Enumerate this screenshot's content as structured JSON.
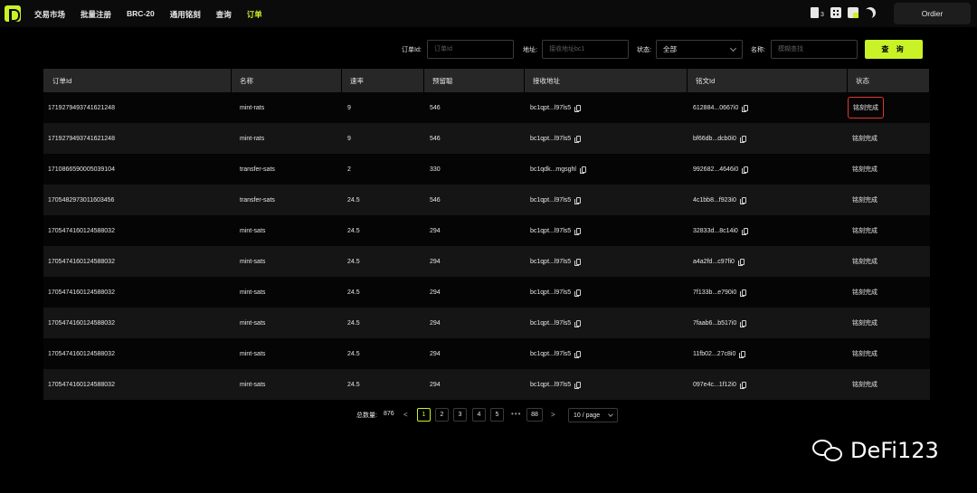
{
  "nav": {
    "items": [
      "交易市场",
      "批量注册",
      "BRC-20",
      "通用铭刻",
      "查询",
      "订单"
    ],
    "active_index": 5
  },
  "toolbar": {
    "file_count": "3",
    "icons": [
      "file-icon",
      "dice-icon",
      "language-icon",
      "moon-icon"
    ],
    "wallet_button": "Ordier"
  },
  "filters": {
    "order_id_label": "订单Id:",
    "order_id_placeholder": "订单Id",
    "address_label": "地址:",
    "address_placeholder": "接收地址bc1",
    "status_label": "状态:",
    "status_value": "全部",
    "name_label": "名称:",
    "name_placeholder": "模糊查找",
    "query_button": "查 询"
  },
  "table": {
    "columns": [
      "订单Id",
      "名称",
      "速率",
      "预留聪",
      "接收地址",
      "铭文Id",
      "状态"
    ],
    "rows": [
      {
        "order_id": "1719279493741621248",
        "name": "mint-rats",
        "rate": "9",
        "sats": "546",
        "address": "bc1qpt...l97ls5",
        "inscription_id": "612884...0667i0",
        "status": "铭刻完成",
        "highlighted": true
      },
      {
        "order_id": "1719279493741621248",
        "name": "mint-rats",
        "rate": "9",
        "sats": "546",
        "address": "bc1qpt...l97ls5",
        "inscription_id": "bf66db...dcb0i0",
        "status": "铭刻完成"
      },
      {
        "order_id": "1710866590005039104",
        "name": "transfer-sats",
        "rate": "2",
        "sats": "330",
        "address": "bc1qdk...mgsghl",
        "inscription_id": "992682...4646i0",
        "status": "铭刻完成"
      },
      {
        "order_id": "1705482973011603456",
        "name": "transfer-sats",
        "rate": "24.5",
        "sats": "546",
        "address": "bc1qpt...l97ls5",
        "inscription_id": "4c1bb8...f923i0",
        "status": "铭刻完成"
      },
      {
        "order_id": "1705474160124588032",
        "name": "mint-sats",
        "rate": "24.5",
        "sats": "294",
        "address": "bc1qpt...l97ls5",
        "inscription_id": "32833d...8c14i0",
        "status": "铭刻完成"
      },
      {
        "order_id": "1705474160124588032",
        "name": "mint-sats",
        "rate": "24.5",
        "sats": "294",
        "address": "bc1qpt...l97ls5",
        "inscription_id": "a4a2fd...c97fi0",
        "status": "铭刻完成"
      },
      {
        "order_id": "1705474160124588032",
        "name": "mint-sats",
        "rate": "24.5",
        "sats": "294",
        "address": "bc1qpt...l97ls5",
        "inscription_id": "7f133b...e790i0",
        "status": "铭刻完成"
      },
      {
        "order_id": "1705474160124588032",
        "name": "mint-sats",
        "rate": "24.5",
        "sats": "294",
        "address": "bc1qpt...l97ls5",
        "inscription_id": "7faab6...b517i0",
        "status": "铭刻完成"
      },
      {
        "order_id": "1705474160124588032",
        "name": "mint-sats",
        "rate": "24.5",
        "sats": "294",
        "address": "bc1qpt...l97ls5",
        "inscription_id": "11fb02...27c8i0",
        "status": "铭刻完成"
      },
      {
        "order_id": "1705474160124588032",
        "name": "mint-sats",
        "rate": "24.5",
        "sats": "294",
        "address": "bc1qpt...l97ls5",
        "inscription_id": "097e4c...1f12i0",
        "status": "铭刻完成"
      }
    ]
  },
  "pagination": {
    "total_label": "总数量:",
    "total": "876",
    "prev": "<",
    "next": ">",
    "pages": [
      "1",
      "2",
      "3",
      "4",
      "5"
    ],
    "ellipsis": "•••",
    "last_page": "88",
    "current": "1",
    "page_size": "10 / page"
  },
  "watermark": {
    "text": "DeFi123"
  },
  "colors": {
    "accent": "#c9f227",
    "highlight_border": "#e2382e",
    "background": "#000000",
    "header_row": "#272727"
  }
}
